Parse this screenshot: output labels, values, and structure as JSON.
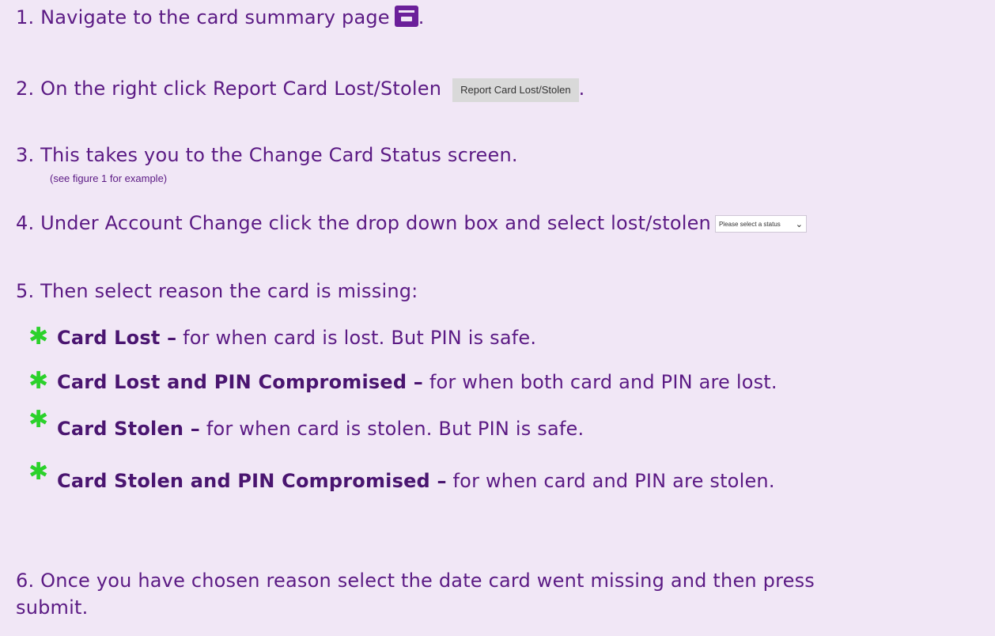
{
  "steps": {
    "s1": "1. Navigate to the card summary page",
    "s1_end": ".",
    "s2": "2. On the right click Report Card Lost/Stolen",
    "s2_button": "Report Card Lost/Stolen",
    "s2_end": ".",
    "s3": "3. This takes you to the Change Card Status screen.",
    "s3_note": "(see figure 1 for example)",
    "s4": "4. Under Account Change click the drop down box and select lost/stolen",
    "s4_select": "Please select a status",
    "s5": "5. Then select reason the card is missing:",
    "s6_line1": "6. Once you have chosen reason select the date card went missing and then press",
    "s6_line2": "submit."
  },
  "reasons": [
    {
      "term": "Card Lost –",
      "desc": " for when card is lost. But PIN is safe."
    },
    {
      "term": "Card Lost and PIN Compromised –",
      "desc": " for when both card and PIN are lost."
    },
    {
      "term": "Card Stolen –",
      "desc": " for when card is stolen. But PIN is safe."
    },
    {
      "term": "Card Stolen and PIN Compromised –",
      "desc": " for when card and PIN are stolen."
    }
  ],
  "icons": {
    "card": "credit-card-icon",
    "bullet": "asterisk-icon",
    "select": "chevron-down-icon"
  },
  "colors": {
    "background": "#f1e7f6",
    "text": "#5b1a84",
    "bullet": "#2bd12b"
  }
}
